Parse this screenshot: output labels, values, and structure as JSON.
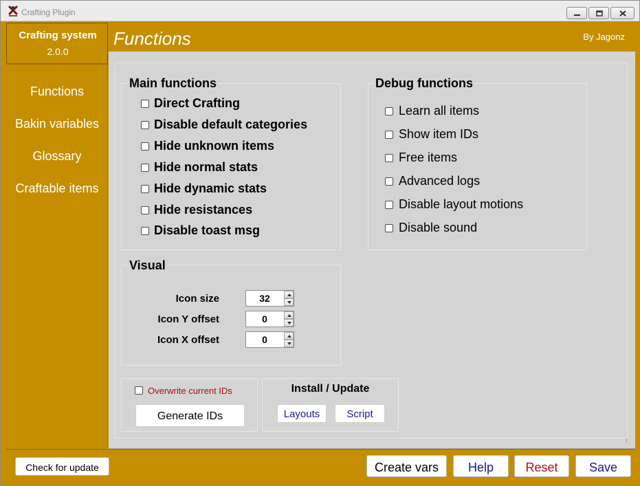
{
  "window": {
    "title": "Crafting Plugin",
    "controls": [
      "minimize-icon",
      "restore-icon",
      "close-icon"
    ]
  },
  "colors": {
    "accent": "#c48e00",
    "panel": "#d4d4d4",
    "reset_text": "#b01010",
    "link_blue": "#1a1a8c",
    "warning_text": "#a01010"
  },
  "sidebar": {
    "title": "Crafting system",
    "version": "2.0.0",
    "items": [
      {
        "label": "Functions"
      },
      {
        "label": "Bakin variables"
      },
      {
        "label": "Glossary"
      },
      {
        "label": "Craftable items"
      }
    ]
  },
  "header": {
    "title": "Functions",
    "author": "By Jagonz"
  },
  "main_functions": {
    "title": "Main functions",
    "options": [
      {
        "label": "Direct Crafting",
        "checked": false
      },
      {
        "label": "Disable default categories",
        "checked": false
      },
      {
        "label": "Hide unknown items",
        "checked": false
      },
      {
        "label": "Hide normal stats",
        "checked": false
      },
      {
        "label": "Hide dynamic stats",
        "checked": false
      },
      {
        "label": "Hide resistances",
        "checked": false
      },
      {
        "label": "Disable toast msg",
        "checked": false
      }
    ]
  },
  "debug_functions": {
    "title": "Debug functions",
    "options": [
      {
        "label": "Learn all items",
        "checked": false
      },
      {
        "label": "Show item IDs",
        "checked": false
      },
      {
        "label": "Free items",
        "checked": false
      },
      {
        "label": "Advanced logs",
        "checked": false
      },
      {
        "label": "Disable layout motions",
        "checked": false
      },
      {
        "label": "Disable sound",
        "checked": false
      }
    ]
  },
  "visual": {
    "title": "Visual",
    "fields": [
      {
        "label": "Icon size",
        "value": "32"
      },
      {
        "label": "Icon Y offset",
        "value": "0"
      },
      {
        "label": "Icon X offset",
        "value": "0"
      }
    ]
  },
  "ids": {
    "overwrite_label": "Overwrite current IDs",
    "overwrite_checked": false,
    "generate_label": "Generate IDs"
  },
  "install": {
    "title": "Install / Update",
    "layouts_label": "Layouts",
    "script_label": "Script"
  },
  "footer": {
    "check_update_label": "Check for update",
    "create_vars_label": "Create vars",
    "help_label": "Help",
    "reset_label": "Reset",
    "save_label": "Save"
  }
}
